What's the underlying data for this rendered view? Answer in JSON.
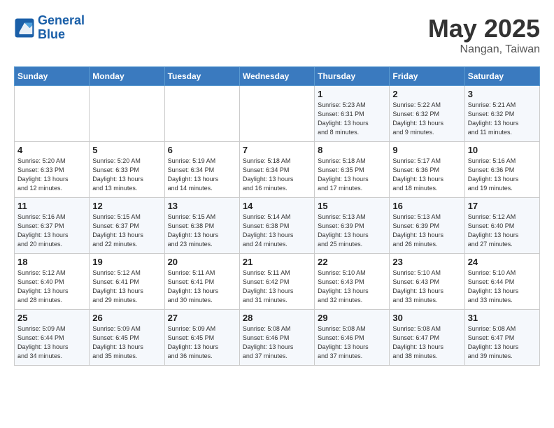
{
  "header": {
    "logo_line1": "General",
    "logo_line2": "Blue",
    "month": "May 2025",
    "location": "Nangan, Taiwan"
  },
  "days_of_week": [
    "Sunday",
    "Monday",
    "Tuesday",
    "Wednesday",
    "Thursday",
    "Friday",
    "Saturday"
  ],
  "weeks": [
    [
      {
        "day": "",
        "info": ""
      },
      {
        "day": "",
        "info": ""
      },
      {
        "day": "",
        "info": ""
      },
      {
        "day": "",
        "info": ""
      },
      {
        "day": "1",
        "info": "Sunrise: 5:23 AM\nSunset: 6:31 PM\nDaylight: 13 hours\nand 8 minutes."
      },
      {
        "day": "2",
        "info": "Sunrise: 5:22 AM\nSunset: 6:32 PM\nDaylight: 13 hours\nand 9 minutes."
      },
      {
        "day": "3",
        "info": "Sunrise: 5:21 AM\nSunset: 6:32 PM\nDaylight: 13 hours\nand 11 minutes."
      }
    ],
    [
      {
        "day": "4",
        "info": "Sunrise: 5:20 AM\nSunset: 6:33 PM\nDaylight: 13 hours\nand 12 minutes."
      },
      {
        "day": "5",
        "info": "Sunrise: 5:20 AM\nSunset: 6:33 PM\nDaylight: 13 hours\nand 13 minutes."
      },
      {
        "day": "6",
        "info": "Sunrise: 5:19 AM\nSunset: 6:34 PM\nDaylight: 13 hours\nand 14 minutes."
      },
      {
        "day": "7",
        "info": "Sunrise: 5:18 AM\nSunset: 6:34 PM\nDaylight: 13 hours\nand 16 minutes."
      },
      {
        "day": "8",
        "info": "Sunrise: 5:18 AM\nSunset: 6:35 PM\nDaylight: 13 hours\nand 17 minutes."
      },
      {
        "day": "9",
        "info": "Sunrise: 5:17 AM\nSunset: 6:36 PM\nDaylight: 13 hours\nand 18 minutes."
      },
      {
        "day": "10",
        "info": "Sunrise: 5:16 AM\nSunset: 6:36 PM\nDaylight: 13 hours\nand 19 minutes."
      }
    ],
    [
      {
        "day": "11",
        "info": "Sunrise: 5:16 AM\nSunset: 6:37 PM\nDaylight: 13 hours\nand 20 minutes."
      },
      {
        "day": "12",
        "info": "Sunrise: 5:15 AM\nSunset: 6:37 PM\nDaylight: 13 hours\nand 22 minutes."
      },
      {
        "day": "13",
        "info": "Sunrise: 5:15 AM\nSunset: 6:38 PM\nDaylight: 13 hours\nand 23 minutes."
      },
      {
        "day": "14",
        "info": "Sunrise: 5:14 AM\nSunset: 6:38 PM\nDaylight: 13 hours\nand 24 minutes."
      },
      {
        "day": "15",
        "info": "Sunrise: 5:13 AM\nSunset: 6:39 PM\nDaylight: 13 hours\nand 25 minutes."
      },
      {
        "day": "16",
        "info": "Sunrise: 5:13 AM\nSunset: 6:39 PM\nDaylight: 13 hours\nand 26 minutes."
      },
      {
        "day": "17",
        "info": "Sunrise: 5:12 AM\nSunset: 6:40 PM\nDaylight: 13 hours\nand 27 minutes."
      }
    ],
    [
      {
        "day": "18",
        "info": "Sunrise: 5:12 AM\nSunset: 6:40 PM\nDaylight: 13 hours\nand 28 minutes."
      },
      {
        "day": "19",
        "info": "Sunrise: 5:12 AM\nSunset: 6:41 PM\nDaylight: 13 hours\nand 29 minutes."
      },
      {
        "day": "20",
        "info": "Sunrise: 5:11 AM\nSunset: 6:41 PM\nDaylight: 13 hours\nand 30 minutes."
      },
      {
        "day": "21",
        "info": "Sunrise: 5:11 AM\nSunset: 6:42 PM\nDaylight: 13 hours\nand 31 minutes."
      },
      {
        "day": "22",
        "info": "Sunrise: 5:10 AM\nSunset: 6:43 PM\nDaylight: 13 hours\nand 32 minutes."
      },
      {
        "day": "23",
        "info": "Sunrise: 5:10 AM\nSunset: 6:43 PM\nDaylight: 13 hours\nand 33 minutes."
      },
      {
        "day": "24",
        "info": "Sunrise: 5:10 AM\nSunset: 6:44 PM\nDaylight: 13 hours\nand 33 minutes."
      }
    ],
    [
      {
        "day": "25",
        "info": "Sunrise: 5:09 AM\nSunset: 6:44 PM\nDaylight: 13 hours\nand 34 minutes."
      },
      {
        "day": "26",
        "info": "Sunrise: 5:09 AM\nSunset: 6:45 PM\nDaylight: 13 hours\nand 35 minutes."
      },
      {
        "day": "27",
        "info": "Sunrise: 5:09 AM\nSunset: 6:45 PM\nDaylight: 13 hours\nand 36 minutes."
      },
      {
        "day": "28",
        "info": "Sunrise: 5:08 AM\nSunset: 6:46 PM\nDaylight: 13 hours\nand 37 minutes."
      },
      {
        "day": "29",
        "info": "Sunrise: 5:08 AM\nSunset: 6:46 PM\nDaylight: 13 hours\nand 37 minutes."
      },
      {
        "day": "30",
        "info": "Sunrise: 5:08 AM\nSunset: 6:47 PM\nDaylight: 13 hours\nand 38 minutes."
      },
      {
        "day": "31",
        "info": "Sunrise: 5:08 AM\nSunset: 6:47 PM\nDaylight: 13 hours\nand 39 minutes."
      }
    ]
  ]
}
